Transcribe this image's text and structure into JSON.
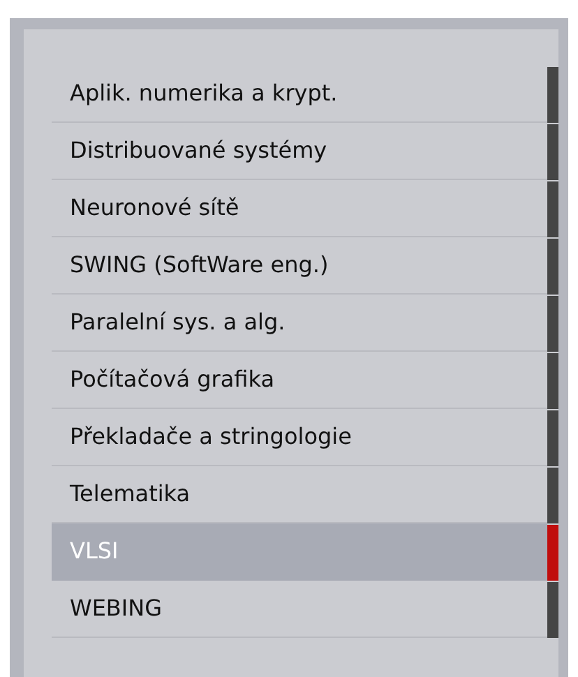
{
  "menu": {
    "items": [
      {
        "label": "Aplik. numerika a krypt.",
        "selected": false
      },
      {
        "label": "Distribuované systémy",
        "selected": false
      },
      {
        "label": "Neuronové sítě",
        "selected": false
      },
      {
        "label": "SWING (SoftWare eng.)",
        "selected": false
      },
      {
        "label": "Paralelní sys. a alg.",
        "selected": false
      },
      {
        "label": "Počítačová grafika",
        "selected": false
      },
      {
        "label": "Překladače a stringologie",
        "selected": false
      },
      {
        "label": "Telematika",
        "selected": false
      },
      {
        "label": "VLSI",
        "selected": true
      },
      {
        "label": "WEBING",
        "selected": false
      }
    ]
  }
}
